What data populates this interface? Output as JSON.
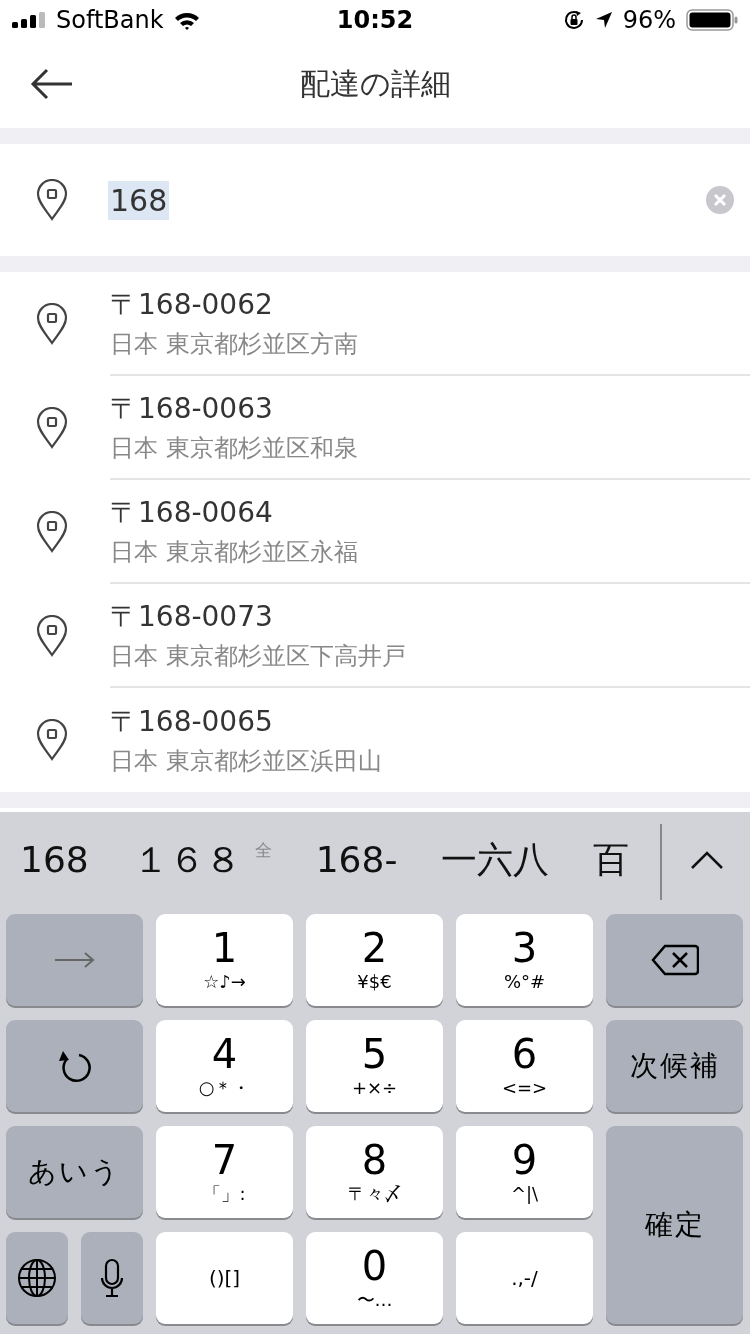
{
  "status_bar": {
    "carrier": "SoftBank",
    "time": "10:52",
    "battery": "96%"
  },
  "nav": {
    "title": "配達の詳細"
  },
  "search": {
    "value": "168"
  },
  "suggestions": [
    {
      "postal": "〒168-0062",
      "address": "日本 東京都杉並区方南"
    },
    {
      "postal": "〒168-0063",
      "address": "日本 東京都杉並区和泉"
    },
    {
      "postal": "〒168-0064",
      "address": "日本 東京都杉並区永福"
    },
    {
      "postal": "〒168-0073",
      "address": "日本 東京都杉並区下高井戸"
    },
    {
      "postal": "〒168-0065",
      "address": "日本 東京都杉並区浜田山"
    }
  ],
  "candidates": [
    {
      "text": "168"
    },
    {
      "text": "１６８",
      "note": "全"
    },
    {
      "text": "168-"
    },
    {
      "text": "一六八"
    },
    {
      "text": "百"
    }
  ],
  "keyboard": {
    "rows": [
      [
        {
          "kind": "arrow"
        },
        {
          "kind": "digit",
          "label": "1",
          "sub": "☆♪→"
        },
        {
          "kind": "digit",
          "label": "2",
          "sub": "¥$€"
        },
        {
          "kind": "digit",
          "label": "3",
          "sub": "%°#"
        },
        {
          "kind": "backspace"
        }
      ],
      [
        {
          "kind": "undo"
        },
        {
          "kind": "digit",
          "label": "4",
          "sub": "○＊・"
        },
        {
          "kind": "digit",
          "label": "5",
          "sub": "+×÷"
        },
        {
          "kind": "digit",
          "label": "6",
          "sub": "<=>"
        },
        {
          "kind": "function",
          "label": "次候補"
        }
      ],
      [
        {
          "kind": "function",
          "label": "あいう"
        },
        {
          "kind": "digit",
          "label": "7",
          "sub": "「」:"
        },
        {
          "kind": "digit",
          "label": "8",
          "sub": "〒々〆"
        },
        {
          "kind": "digit",
          "label": "9",
          "sub": "^|\\"
        },
        {
          "kind": "enter",
          "label": "確定"
        }
      ],
      [
        {
          "kind": "pair",
          "keys": [
            {
              "kind": "globe"
            },
            {
              "kind": "mic"
            }
          ]
        },
        {
          "kind": "symbols",
          "label": "()[]"
        },
        {
          "kind": "digit",
          "label": "0",
          "sub": "〜…"
        },
        {
          "kind": "symbols",
          "label": ".,-/"
        }
      ]
    ]
  }
}
